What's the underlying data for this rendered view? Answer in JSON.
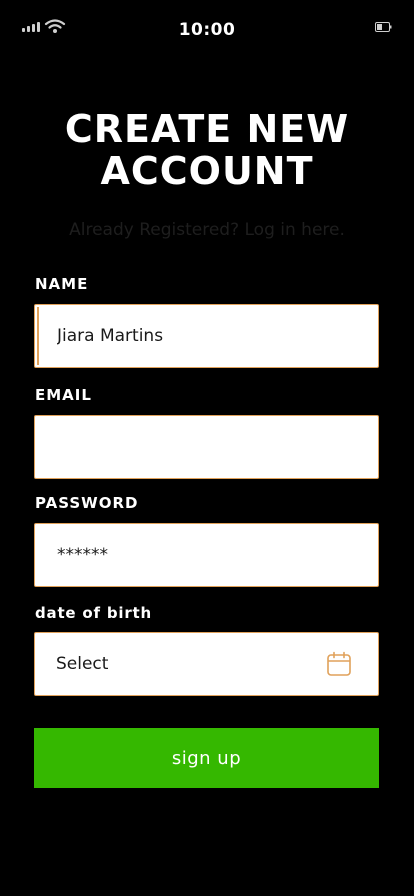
{
  "status_bar": {
    "time": "10:00",
    "icons": [
      "signal-icon",
      "wifi-icon",
      "battery-icon"
    ]
  },
  "header": {
    "title": "CREATE NEW ACCOUNT",
    "login_prompt": "Already Registered? Log in here."
  },
  "form": {
    "name": {
      "label": "NAME",
      "value": "Jiara Martins"
    },
    "email": {
      "label": "EMAIL",
      "value": ""
    },
    "password": {
      "label": "PASSWORD",
      "value": "******"
    },
    "dob": {
      "label": "date of birth",
      "value": "Select",
      "icon": "calendar-icon"
    },
    "submit_label": "sign up"
  },
  "colors": {
    "background": "#000000",
    "field_border": "#e0a15a",
    "button": "#35b800",
    "accent_icon": "#e0a15a"
  }
}
